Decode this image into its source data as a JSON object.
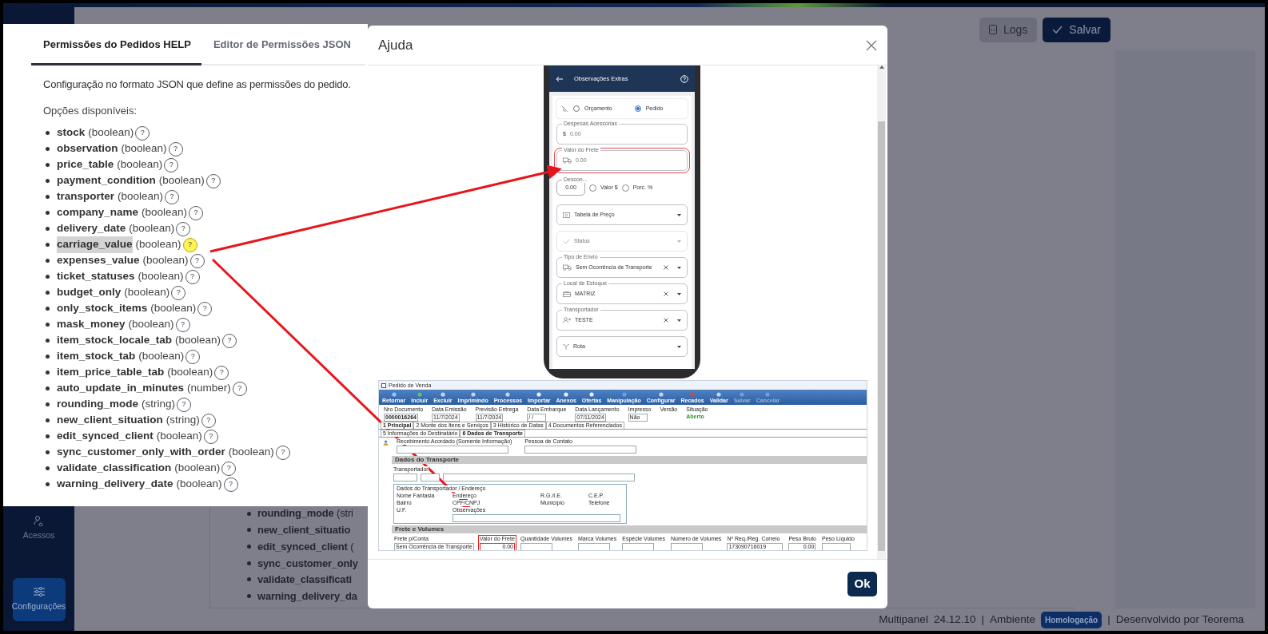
{
  "app": {
    "sidebar": [
      {
        "label": "Acessos",
        "selected": false
      },
      {
        "label": "Configurações",
        "selected": true
      }
    ],
    "header_buttons": [
      {
        "label": "Logs",
        "kind": "secondary"
      },
      {
        "label": "Salvar",
        "kind": "primary"
      }
    ],
    "background_list": [
      "**rounding_mode** (stri",
      "**new_client_situatio**",
      "**edit_synced_client** (",
      "**sync_customer_only**",
      "**validate_classificati**",
      "**warning_delivery_da**"
    ],
    "footer": {
      "product": "Multipanel",
      "version": "24.12.10",
      "separators": [
        "|",
        "|"
      ],
      "env_label": "Ambiente",
      "env_badge": "Homologação",
      "credit": "Desenvolvido por Teorema"
    }
  },
  "help_panel": {
    "tabs": [
      {
        "label": "Permissões do Pedidos HELP",
        "selected": true
      },
      {
        "label": "Editor de Permissões JSON",
        "selected": false
      }
    ],
    "description": "Configuração no formato JSON que define as permissões do pedido.",
    "options_title": "Opções disponíveis:",
    "options": [
      {
        "name": "stock",
        "type": "(boolean)",
        "help": "?",
        "highlighted": false
      },
      {
        "name": "observation",
        "type": "(boolean)",
        "help": "?",
        "highlighted": false
      },
      {
        "name": "price_table",
        "type": "(boolean)",
        "help": "?",
        "highlighted": false
      },
      {
        "name": "payment_condition",
        "type": "(boolean)",
        "help": "?",
        "highlighted": false
      },
      {
        "name": "transporter",
        "type": "(boolean)",
        "help": "?",
        "highlighted": false
      },
      {
        "name": "company_name",
        "type": "(boolean)",
        "help": "?",
        "highlighted": false
      },
      {
        "name": "delivery_date",
        "type": "(boolean)",
        "help": "?",
        "highlighted": false
      },
      {
        "name": "carriage_value",
        "type": "(boolean)",
        "help": "?",
        "highlighted": true
      },
      {
        "name": "expenses_value",
        "type": "(boolean)",
        "help": "?",
        "highlighted": false
      },
      {
        "name": "ticket_statuses",
        "type": "(boolean)",
        "help": "?",
        "highlighted": false
      },
      {
        "name": "budget_only",
        "type": "(boolean)",
        "help": "?",
        "highlighted": false
      },
      {
        "name": "only_stock_items",
        "type": "(boolean)",
        "help": "?",
        "highlighted": false
      },
      {
        "name": "mask_money",
        "type": "(boolean)",
        "help": "?",
        "highlighted": false
      },
      {
        "name": "item_stock_locale_tab",
        "type": "(boolean)",
        "help": "?",
        "highlighted": false
      },
      {
        "name": "item_stock_tab",
        "type": "(boolean)",
        "help": "?",
        "highlighted": false
      },
      {
        "name": "item_price_table_tab",
        "type": "(boolean)",
        "help": "?",
        "highlighted": false
      },
      {
        "name": "auto_update_in_minutes",
        "type": "(number)",
        "help": "?",
        "highlighted": false
      },
      {
        "name": "rounding_mode",
        "type": "(string)",
        "help": "?",
        "highlighted": false
      },
      {
        "name": "new_client_situation",
        "type": "(string)",
        "help": "?",
        "highlighted": false
      },
      {
        "name": "edit_synced_client",
        "type": "(boolean)",
        "help": "?",
        "highlighted": false
      },
      {
        "name": "sync_customer_only_with_order",
        "type": "(boolean)",
        "help": "?",
        "highlighted": false
      },
      {
        "name": "validate_classification",
        "type": "(boolean)",
        "help": "?",
        "highlighted": false
      },
      {
        "name": "warning_delivery_date",
        "type": "(boolean)",
        "help": "?",
        "highlighted": false
      }
    ]
  },
  "modal": {
    "title": "Ajuda",
    "ok": "Ok",
    "phone": {
      "title": "Observações Extras",
      "radios": [
        {
          "label": "Orçamento",
          "selected": false
        },
        {
          "label": "Pedido",
          "selected": true
        }
      ],
      "fields": [
        {
          "kind": "input",
          "label": "Despesas Acessórias",
          "prefix": "$",
          "value": "0.00",
          "highlighted": false
        },
        {
          "kind": "input",
          "label": "Valor do Frete",
          "value": "0.00",
          "highlighted": true
        },
        {
          "kind": "discount",
          "label": "Descon...",
          "value": "0.00",
          "options": [
            {
              "label": "Valor $",
              "selected": false
            },
            {
              "label": "Porc. %",
              "selected": false
            }
          ]
        },
        {
          "kind": "select",
          "value": "Tabela de Preço",
          "disabled": false,
          "clearable": false
        },
        {
          "kind": "select",
          "value": "Status",
          "disabled": true,
          "clearable": false
        },
        {
          "kind": "select",
          "label": "Tipo de Envio",
          "value": "Sem Ocorrência de Transporte",
          "disabled": false,
          "clearable": true
        },
        {
          "kind": "select",
          "label": "Local de Estoque",
          "value": "MATRIZ",
          "disabled": false,
          "clearable": true
        },
        {
          "kind": "select",
          "label": "Transportador",
          "value": "TESTE",
          "disabled": false,
          "clearable": true
        },
        {
          "kind": "select",
          "value": "Rota",
          "disabled": false,
          "clearable": false
        }
      ]
    },
    "desktop": {
      "title": "Pedido de Venda",
      "toolbar": [
        {
          "label": "Retornar",
          "disabled": false
        },
        {
          "label": "Incluir",
          "disabled": false
        },
        {
          "label": "Excluir",
          "disabled": false
        },
        {
          "label": "Imprimindo",
          "disabled": false
        },
        {
          "label": "Processos",
          "disabled": false
        },
        {
          "label": "Importar",
          "disabled": false
        },
        {
          "label": "Anexos",
          "disabled": false
        },
        {
          "label": "Ofertas",
          "disabled": false
        },
        {
          "label": "Manipulação",
          "disabled": false
        },
        {
          "label": "Configurar",
          "disabled": false
        },
        {
          "label": "Recados",
          "disabled": false
        },
        {
          "label": "Validar",
          "disabled": false
        },
        {
          "label": "Salvar",
          "disabled": true
        },
        {
          "label": "Cancelar",
          "disabled": true
        }
      ],
      "header_fields": [
        {
          "label": "Nro Documento",
          "value": "0000016264"
        },
        {
          "label": "Data Emissão",
          "value": "11/7/2024"
        },
        {
          "label": "Previsão Entrega",
          "value": "11/7/2024"
        },
        {
          "label": "Data Embarque",
          "value": "/ /"
        },
        {
          "label": "Data Lançamento",
          "value": "07/11/2024"
        },
        {
          "label": "Impresso",
          "value": "Não"
        },
        {
          "label": "Versão"
        },
        {
          "label": "Situação",
          "value": "Aberto"
        }
      ],
      "tabs": [
        {
          "label": "1 Principal",
          "selected": true
        },
        {
          "label": "2 Monte dos Itens e Serviços",
          "selected": false
        },
        {
          "label": "3 Histórico de Datas",
          "selected": false
        },
        {
          "label": "4 Documentos Referenciados",
          "selected": false
        }
      ],
      "subtabs": [
        {
          "label": "5 Informações do Destinatário",
          "selected": false
        },
        {
          "label": "6 Dados de Transporte",
          "selected": true
        }
      ],
      "top_fields": [
        "Recebimento Acordado (Somente Informação)",
        "Pessoa de Contato"
      ],
      "transport_section": "Dados do Transporte",
      "transporter_label": "Transportador",
      "address_group": "Dados do Transportador / Endereço",
      "address_labels": [
        "Nome Fantasia",
        "Endereço",
        "R.G./I.E.",
        "C.E.P.",
        "Bairro",
        "CPF/CNPJ",
        "Município",
        "Telefone",
        "U.F.",
        "Observações"
      ],
      "freight_section": "Frete e Volumes",
      "freight_fields": [
        {
          "label": "Frete p/Conta",
          "value": "Sem Ocorrência de Transporte",
          "highlighted": false
        },
        {
          "label": "Valor do Frete",
          "value": "0.00",
          "highlighted": true
        },
        {
          "label": "Quantidade Volumes",
          "highlighted": false
        },
        {
          "label": "Marca Volumes",
          "highlighted": false
        },
        {
          "label": "Espécie Volumes",
          "highlighted": false
        },
        {
          "label": "Número de Volumes",
          "highlighted": false
        },
        {
          "label": "Nº Req./Reg. Correio",
          "value": "173090716019",
          "highlighted": false
        },
        {
          "label": "Peso Bruto",
          "value": "0.00",
          "highlighted": false
        },
        {
          "label": "Peso Líquido",
          "highlighted": false
        }
      ]
    }
  }
}
